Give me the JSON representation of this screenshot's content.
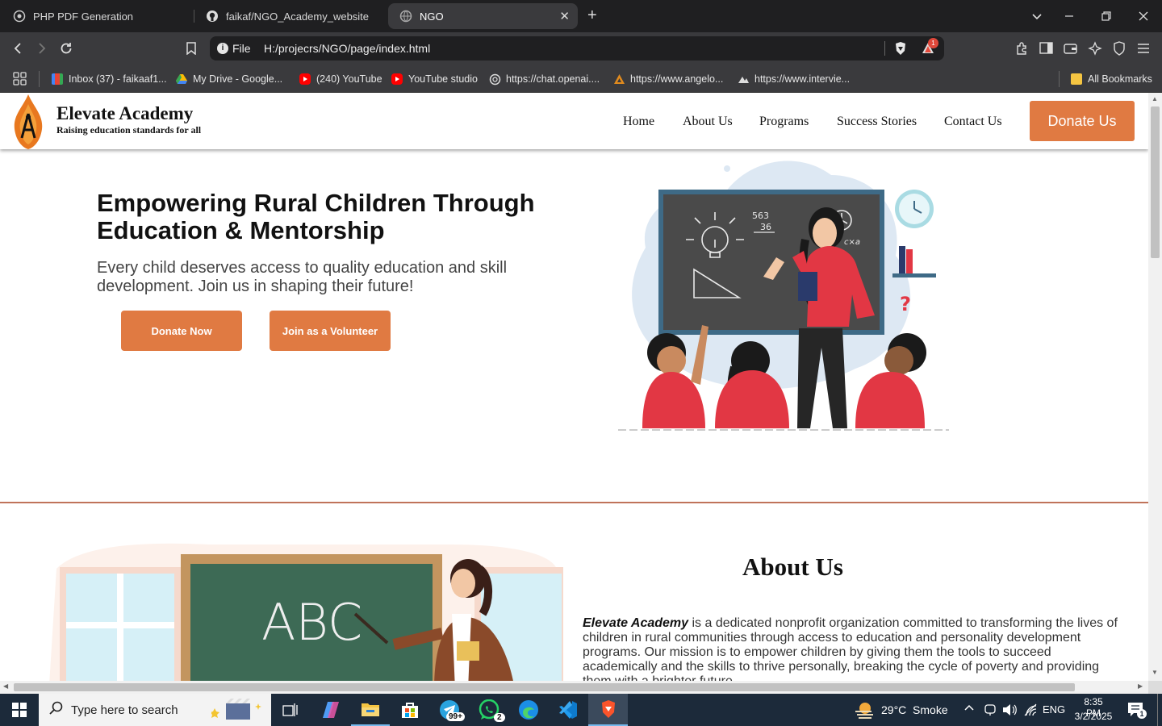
{
  "browser": {
    "tabs": [
      {
        "title": "PHP PDF Generation",
        "icon": "globe-icon"
      },
      {
        "title": "faikaf/NGO_Academy_website",
        "icon": "github-icon"
      },
      {
        "title": "NGO",
        "icon": "globe-icon",
        "active": true
      }
    ],
    "address": {
      "scheme_label": "File",
      "url": "H:/projecrs/NGO/page/index.html"
    },
    "shield_badge": "1",
    "bookmarks": [
      {
        "label": "Inbox (37) - faikaaf1...",
        "icon": "gmail-icon"
      },
      {
        "label": "My Drive - Google...",
        "icon": "drive-icon"
      },
      {
        "label": "(240) YouTube",
        "icon": "youtube-icon"
      },
      {
        "label": "YouTube studio",
        "icon": "youtube-icon"
      },
      {
        "label": "https://chat.openai....",
        "icon": "openai-icon"
      },
      {
        "label": "https://www.angelo...",
        "icon": "angelo-icon"
      },
      {
        "label": "https://www.intervie...",
        "icon": "interview-icon"
      }
    ],
    "all_bookmarks": "All Bookmarks"
  },
  "site": {
    "brand": {
      "name": "Elevate Academy",
      "tagline": "Raising education standards for all"
    },
    "nav": [
      "Home",
      "About Us",
      "Programs",
      "Success Stories",
      "Contact Us"
    ],
    "donate_header": "Donate Us",
    "hero": {
      "title_line1": "Empowering Rural Children Through",
      "title_line2": "Education & Mentorship",
      "subtitle_line1": "Every child deserves access to quality education and skill",
      "subtitle_line2": "development. Join us in shaping their future!",
      "donate_now": "Donate Now",
      "volunteer": "Join as a Volunteer"
    },
    "about": {
      "heading": "About Us",
      "org_name": "Elevate Academy",
      "body_line1": " is a dedicated nonprofit organization committed to transforming the lives of",
      "body_line2": "children in rural communities through access to education and personality development",
      "body_line3": "programs. Our mission is to empower children by giving them the tools to succeed",
      "body_line4": "academically and the skills to thrive personally, breaking the cycle of poverty and providing",
      "body_line5": "them with a brighter future."
    },
    "illustration": {
      "board_math_top": "563",
      "board_math_bottom": "36",
      "board_formula": "c×a",
      "abc_text": "ABC"
    },
    "colors": {
      "accent": "#e07a42",
      "divider": "#c0735a"
    }
  },
  "taskbar": {
    "search_placeholder": "Type here to search",
    "telegram_badge": "99+",
    "whatsapp_badge": "2",
    "weather": "29°C  Smoke",
    "lang": "ENG",
    "time": "8:35 PM",
    "date": "3/2/2025",
    "notif_count": "1"
  }
}
